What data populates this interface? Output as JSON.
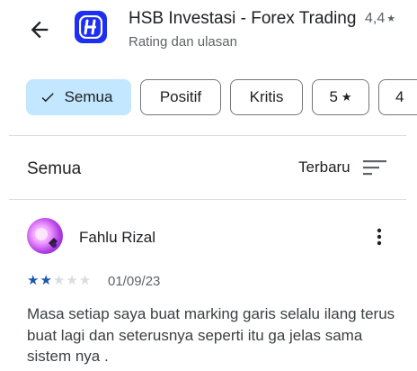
{
  "header": {
    "app_title": "HSB Investasi - Forex Trading",
    "subtitle": "Rating dan ulasan",
    "rating": "4,4",
    "rating_icon": "star-icon"
  },
  "filters": [
    {
      "label": "Semua",
      "selected": true
    },
    {
      "label": "Positif",
      "selected": false
    },
    {
      "label": "Kritis",
      "selected": false
    },
    {
      "label": "5",
      "selected": false,
      "icon": "star-icon"
    },
    {
      "label": "4",
      "selected": false
    }
  ],
  "sort": {
    "label": "Semua",
    "order": "Terbaru"
  },
  "review": {
    "author": "Fahlu Rizal",
    "rating": 2,
    "max_rating": 5,
    "date": "01/09/23",
    "text": "Masa setiap saya buat marking garis selalu ilang terus buat lagi dan seterusnya seperti itu ga jelas sama sistem nya ."
  },
  "colors": {
    "accent_chip": "#c2e7ff",
    "app_icon": "#1d2ff0",
    "star_filled": "#1a56b0"
  }
}
